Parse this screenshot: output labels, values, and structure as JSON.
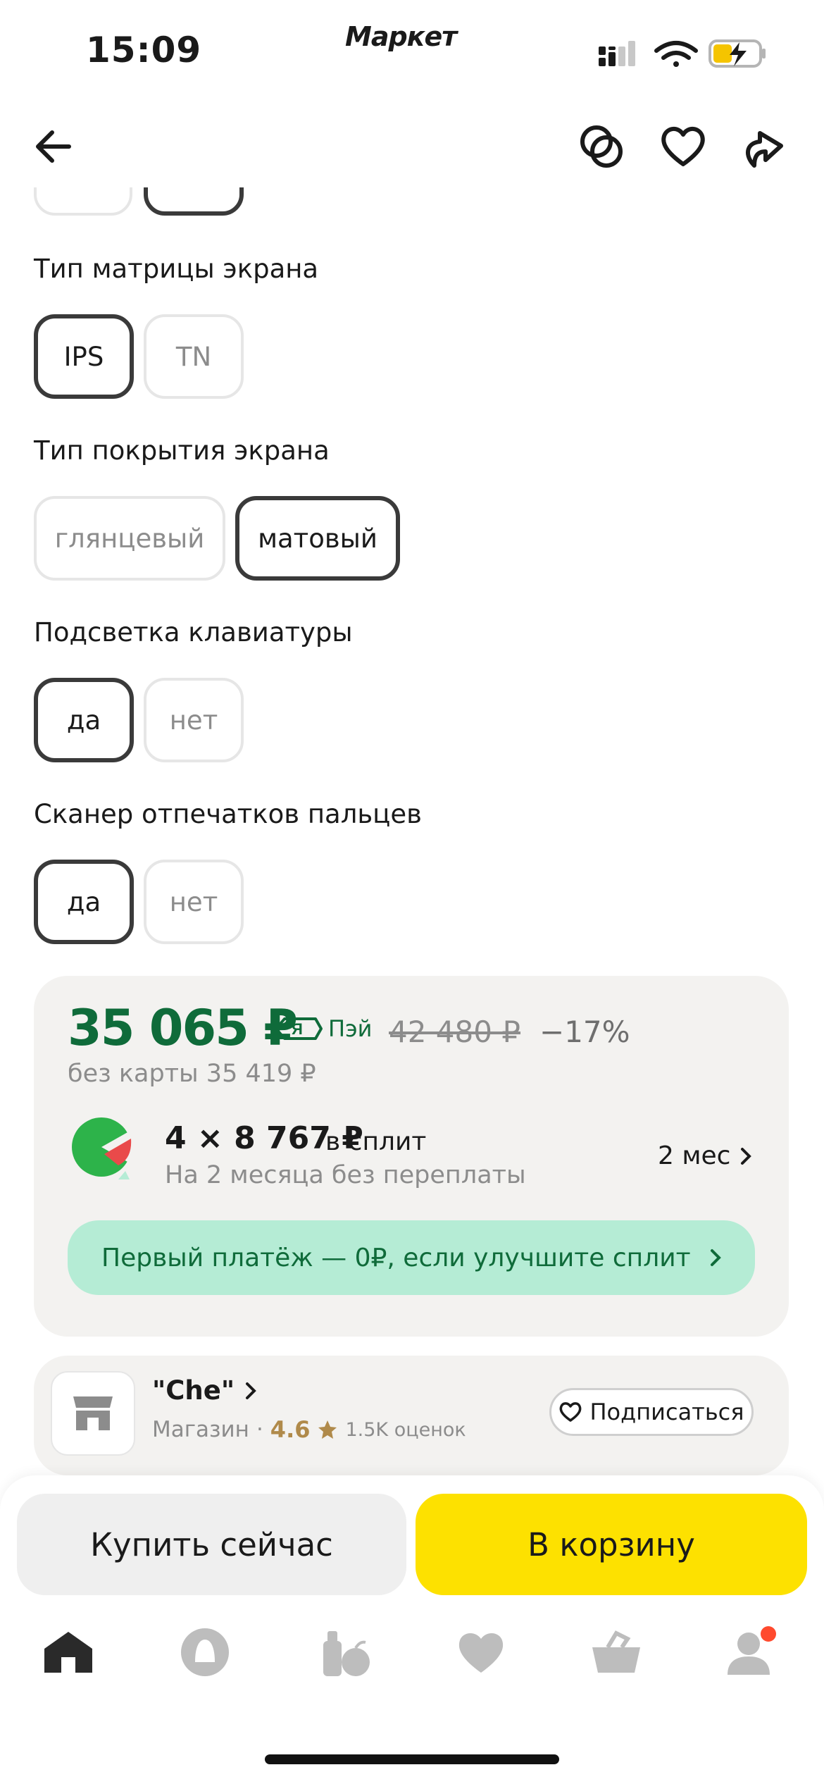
{
  "status_bar": {
    "time": "15:09",
    "app_logo": "Маркет"
  },
  "header": {
    "back_icon": "arrow-left-icon",
    "compare_icon": "compare-circles-icon",
    "favorite_icon": "heart-outline-icon",
    "share_icon": "share-arrow-icon"
  },
  "filters": [
    {
      "label": "Тип матрицы экрана",
      "options": [
        {
          "text": "IPS",
          "selected": true
        },
        {
          "text": "TN",
          "selected": false
        }
      ]
    },
    {
      "label": "Тип покрытия экрана",
      "options": [
        {
          "text": "глянцевый",
          "selected": false
        },
        {
          "text": "матовый",
          "selected": true
        }
      ]
    },
    {
      "label": "Подсветка клавиатуры",
      "options": [
        {
          "text": "да",
          "selected": true
        },
        {
          "text": "нет",
          "selected": false
        }
      ]
    },
    {
      "label": "Сканер отпечатков пальцев",
      "options": [
        {
          "text": "да",
          "selected": true
        },
        {
          "text": "нет",
          "selected": false
        }
      ]
    }
  ],
  "price": {
    "current": "35 065 ₽",
    "pay_badge": "Пэй",
    "old": "42 480 ₽",
    "discount": "−17%",
    "without_card": "без карты 35 419 ₽"
  },
  "split": {
    "amount": "4 × 8 767 ₽",
    "amount_suffix": "в сплит",
    "subtitle": "На 2 месяца без переплаты",
    "months": "2 мес",
    "promo": "Первый платёж — 0₽, если улучшите сплит"
  },
  "shop": {
    "name": "\"Che\"",
    "type": "Магазин",
    "rating": "4.6",
    "reviews": "1.5K оценок",
    "subscribe_label": "Подписаться"
  },
  "actions": {
    "buy_now": "Купить сейчас",
    "to_cart": "В корзину"
  },
  "tabbar": {
    "items": [
      "home-icon",
      "alice-icon",
      "catalog-icon",
      "favorites-icon",
      "cart-icon",
      "profile-icon"
    ],
    "active": "home-icon",
    "accent": "#fde100",
    "notification_color": "#ff4a2e"
  }
}
